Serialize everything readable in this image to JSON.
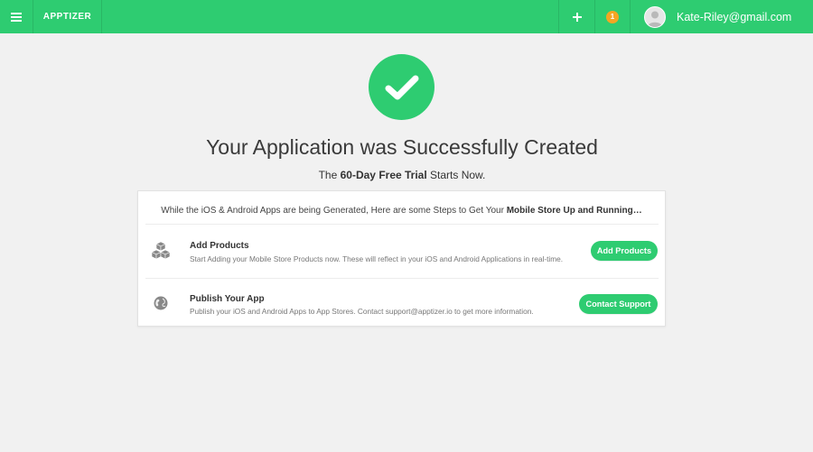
{
  "header": {
    "brand": "APPTIZER",
    "notification_count": "1",
    "user_email": "Kate-Riley@gmail.com",
    "icons": {
      "menu": "hamburger-icon",
      "add": "plus-icon",
      "user": "avatar"
    }
  },
  "success": {
    "title": "Your Application was Successfully Created",
    "subtitle_prefix": "The",
    "subtitle_bold": "60-Day Free Trial",
    "subtitle_suffix": "Starts Now."
  },
  "card": {
    "intro_text": "While the iOS & Android Apps are being Generated, Here are some Steps to Get Your",
    "intro_bold": "Mobile Store Up and Running…",
    "steps": [
      {
        "icon": "boxes-icon",
        "title": "Add Products",
        "description": "Start Adding your Mobile Store Products now. These will reflect in your iOS and Android Applications in real-time.",
        "button": "Add Products"
      },
      {
        "icon": "globe-icon",
        "title": "Publish Your App",
        "description": "Publish your iOS and Android Apps to App Stores. Contact support@apptizer.io to get more information.",
        "button": "Contact Support"
      }
    ]
  },
  "colors": {
    "brand_green": "#2ecc71",
    "badge_orange": "#f5a623",
    "page_bg": "#f1f1f1"
  }
}
